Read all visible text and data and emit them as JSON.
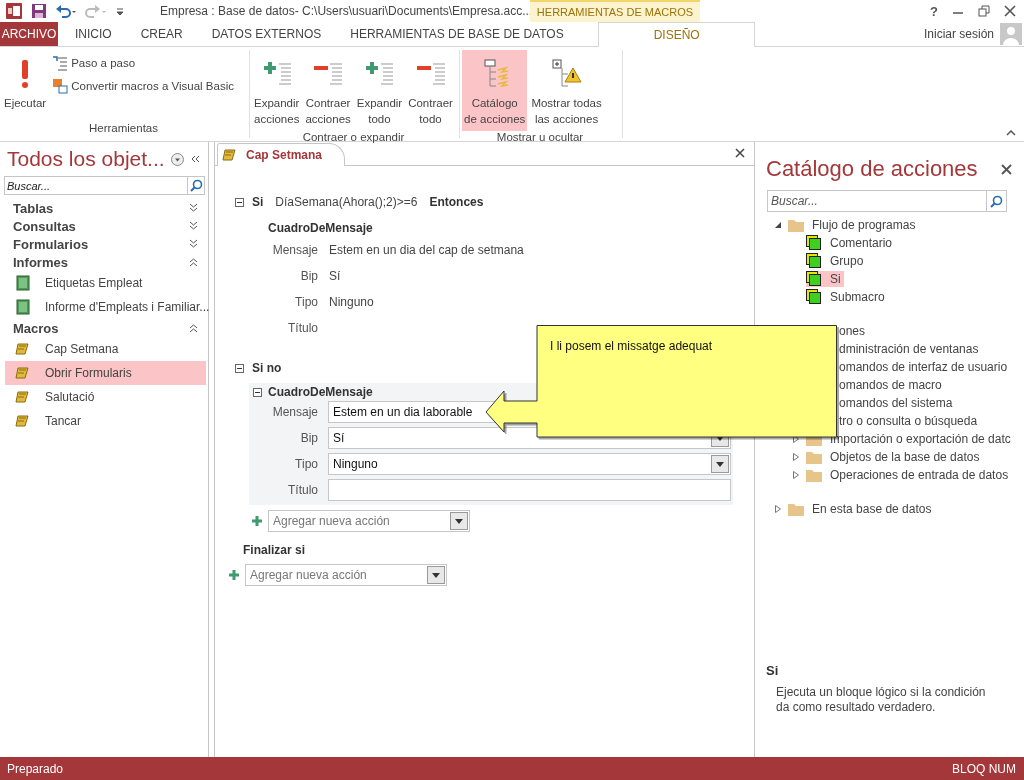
{
  "window": {
    "title": "Empresa : Base de datos- C:\\Users\\usuari\\Documents\\Empresa.acc...",
    "context_tab": "HERRAMIENTAS DE MACROS",
    "help": "?"
  },
  "ribbon_tabs": [
    {
      "label": "ARCHIVO",
      "kind": "file",
      "selected": false
    },
    {
      "label": "INICIO",
      "kind": "tab",
      "selected": false
    },
    {
      "label": "CREAR",
      "kind": "tab",
      "selected": false
    },
    {
      "label": "DATOS EXTERNOS",
      "kind": "tab",
      "selected": false
    },
    {
      "label": "HERRAMIENTAS DE BASE DE DATOS",
      "kind": "tab",
      "selected": false
    },
    {
      "label": "DISEÑO",
      "kind": "context",
      "selected": true
    }
  ],
  "account": {
    "label": "Iniciar sesión"
  },
  "ribbon_groups": [
    {
      "label": "Herramientas",
      "buttons": [
        {
          "label": "Ejecutar",
          "kind": "large",
          "selected": false
        },
        {
          "label": "Paso a paso",
          "kind": "small",
          "selected": false
        },
        {
          "label": "Convertir macros a Visual Basic",
          "kind": "small",
          "selected": false
        }
      ]
    },
    {
      "label": "Contraer o expandir",
      "buttons": [
        {
          "label": "Expandir\nacciones",
          "kind": "large",
          "selected": false
        },
        {
          "label": "Contraer\nacciones",
          "kind": "large",
          "selected": false
        },
        {
          "label": "Expandir\ntodo",
          "kind": "large",
          "selected": false
        },
        {
          "label": "Contraer\ntodo",
          "kind": "large",
          "selected": false
        }
      ]
    },
    {
      "label": "Mostrar u ocultar",
      "buttons": [
        {
          "label": "Catálogo\nde acciones",
          "kind": "large",
          "selected": true
        },
        {
          "label": "Mostrar todas\nlas acciones",
          "kind": "large",
          "selected": false
        }
      ]
    }
  ],
  "nav": {
    "title": "Todos los objet...",
    "search": {
      "placeholder": "Buscar..."
    },
    "groups": [
      {
        "label": "Tablas",
        "expanded": false
      },
      {
        "label": "Consultas",
        "expanded": false
      },
      {
        "label": "Formularios",
        "expanded": false
      },
      {
        "label": "Informes",
        "expanded": true,
        "items": [
          {
            "label": "Etiquetas Empleat",
            "kind": "report",
            "selected": false
          },
          {
            "label": "Informe d'Empleats i Familiar...",
            "kind": "report",
            "selected": false
          }
        ]
      },
      {
        "label": "Macros",
        "expanded": true,
        "items": [
          {
            "label": "Cap Setmana",
            "kind": "macro",
            "selected": false
          },
          {
            "label": "Obrir Formularis",
            "kind": "macro",
            "selected": true
          },
          {
            "label": "Salutació",
            "kind": "macro",
            "selected": false
          },
          {
            "label": "Tancar",
            "kind": "macro",
            "selected": false
          }
        ]
      }
    ]
  },
  "document_tab": {
    "label": "Cap Setmana"
  },
  "macro": {
    "if_block": {
      "keyword": "Si",
      "condition": "DíaSemana(Ahora();2)>=6",
      "then": "Entonces",
      "expanded": true,
      "action": {
        "name": "CuadroDeMensaje",
        "arguments": [
          {
            "label": "Mensaje",
            "value": "Estem en un dia del cap de setmana"
          },
          {
            "label": "Bip",
            "value": "Sí"
          },
          {
            "label": "Tipo",
            "value": "Ninguno"
          },
          {
            "label": "Título"
          }
        ]
      }
    },
    "else_block": {
      "keyword": "Si no",
      "expanded": true,
      "action": {
        "name": "CuadroDeMensaje",
        "expanded": true,
        "arguments": [
          {
            "label": "Mensaje",
            "kind": "text",
            "value": "Estem en un dia laborable"
          },
          {
            "label": "Bip",
            "kind": "dropdown",
            "value": "Sí"
          },
          {
            "label": "Tipo",
            "kind": "dropdown",
            "value": "Ninguno"
          },
          {
            "label": "Título",
            "kind": "text"
          }
        ]
      },
      "add_action": {
        "placeholder": "Agregar nueva acción"
      }
    },
    "end_if": "Finalizar si",
    "add_action": {
      "placeholder": "Agregar nueva acción"
    }
  },
  "callout": {
    "text": "I li posem el missatge adequat"
  },
  "catalog": {
    "title": "Catálogo de acciones",
    "search": {
      "placeholder": "Buscar..."
    },
    "tree": [
      {
        "label": "Flujo de programas",
        "kind": "folder",
        "expanded": true,
        "children": [
          {
            "label": "Comentario",
            "kind": "action",
            "selected": false
          },
          {
            "label": "Grupo",
            "kind": "action",
            "selected": false
          },
          {
            "label": "Si",
            "kind": "action",
            "selected": true
          },
          {
            "label": "Submacro",
            "kind": "action",
            "selected": false
          }
        ]
      },
      {
        "label": "ones",
        "kind": "partial",
        "children": [
          {
            "label": "dministración de ventanas",
            "kind": "partial"
          },
          {
            "label": "omandos de interfaz de usuario",
            "kind": "partial"
          },
          {
            "label": "omandos de macro",
            "kind": "partial"
          },
          {
            "label": "omandos del sistema",
            "kind": "partial"
          },
          {
            "label": "tro o consulta o búsqueda",
            "kind": "partial"
          },
          {
            "label": "Importación o exportación de datc",
            "kind": "folder",
            "expanded": false
          },
          {
            "label": "Objetos de la base de datos",
            "kind": "folder",
            "expanded": false
          },
          {
            "label": "Operaciones de entrada de datos",
            "kind": "folder",
            "expanded": false
          }
        ]
      },
      {
        "label": "En esta base de datos",
        "kind": "folder",
        "expanded": false
      }
    ],
    "info": {
      "title": "Si",
      "description": "Ejecuta un bloque lógico si la condición da como resultado verdadero."
    }
  },
  "status_bar": {
    "left": "Preparado",
    "right": "BLOQ NUM"
  }
}
